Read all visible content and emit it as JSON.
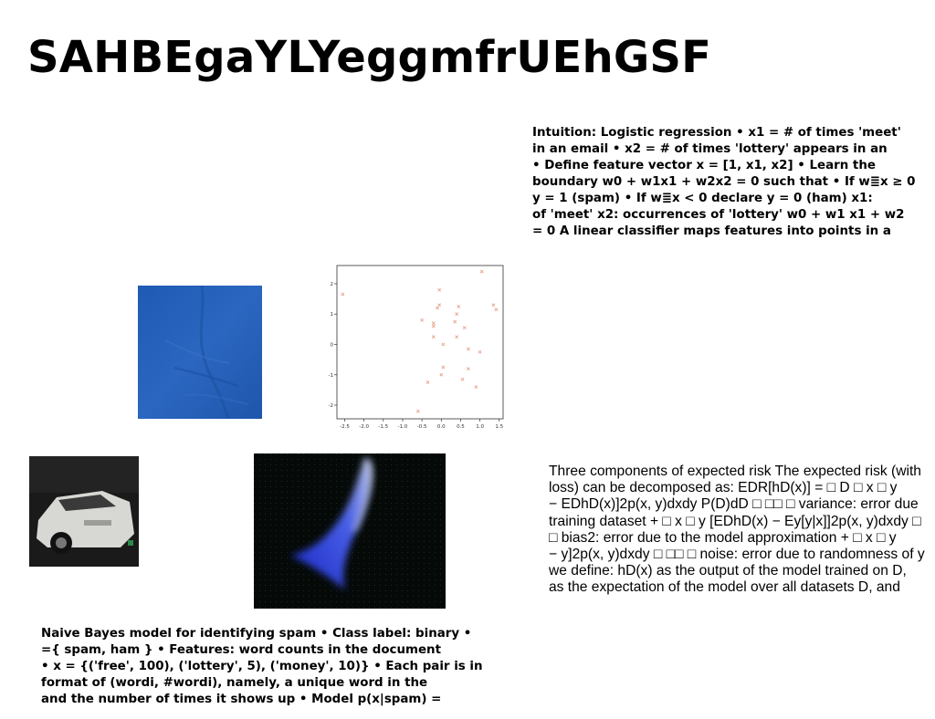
{
  "title": "SAHBEgaYLYeggmfrUEhGSF",
  "right_top_text": [
    "Intuition: Logistic regression • x1 = # of times 'meet'",
    "in an email • x2 = # of times 'lottery' appears in an",
    "• Define feature vector x = [1, x1, x2] • Learn the",
    "boundary w0 + w1x1 + w2x2 = 0 such that • If w≣x ≥ 0",
    "y = 1 (spam) • If w≣x < 0 declare y = 0 (ham) x1:",
    "of 'meet' x2: occurrences of 'lottery' w0 + w1 x1 + w2",
    "= 0 A linear classifier maps features into points in a"
  ],
  "right_bottom_text": [
    "Three components of expected risk The expected risk (with",
    "loss) can be decomposed as: EDR[hD(x)] = □ D □ x □ y",
    "− EDhD(x)]2p(x, y)dxdy P(D)dD □ □□ □ variance: error due",
    "training dataset + □ x □ y [EDhD(x) − Ey[y|x]]2p(x, y)dxdy □",
    "□ bias2: error due to the model approximation + □ x □ y",
    "− y]2p(x, y)dxdy □ □□ □ noise: error due to randomness of y",
    "we define: hD(x) as the output of the model trained on D,",
    "as the expectation of the model over all datasets D, and"
  ],
  "left_bottom_text": [
    "Naive Bayes model for identifying spam • Class label: binary •",
    "={ spam, ham } • Features: word counts in the document",
    "• x = {('free', 100), ('lottery', 5), ('money', 10)} • Each pair is in",
    "format of (wordi, #wordi), namely, a unique word in the",
    "and the number of times it shows up • Model p(x|spam) ="
  ],
  "chart_data": {
    "type": "scatter",
    "title": "",
    "xlabel": "",
    "ylabel": "",
    "xlim": [
      -2.7,
      1.6
    ],
    "ylim": [
      -2.45,
      2.6
    ],
    "xticks": [
      "-2.5",
      "-2.0",
      "-1.5",
      "-1.0",
      "-0.5",
      "0.0",
      "0.5",
      "1.0",
      "1.5"
    ],
    "yticks": [
      "-2",
      "-1",
      "0",
      "1",
      "2"
    ],
    "marker_color": "#e8a28c",
    "points": [
      {
        "x": -2.55,
        "y": 1.65
      },
      {
        "x": -0.6,
        "y": -2.2
      },
      {
        "x": -0.5,
        "y": 0.8
      },
      {
        "x": -0.35,
        "y": -1.25
      },
      {
        "x": -0.2,
        "y": 0.7
      },
      {
        "x": -0.2,
        "y": 0.6
      },
      {
        "x": -0.2,
        "y": 0.25
      },
      {
        "x": -0.1,
        "y": 1.2
      },
      {
        "x": -0.05,
        "y": 1.8
      },
      {
        "x": -0.05,
        "y": 1.3
      },
      {
        "x": 0.0,
        "y": -1.0
      },
      {
        "x": 0.05,
        "y": -0.75
      },
      {
        "x": 0.05,
        "y": 0.0
      },
      {
        "x": 0.35,
        "y": 0.75
      },
      {
        "x": 0.4,
        "y": 1.0
      },
      {
        "x": 0.45,
        "y": 1.25
      },
      {
        "x": 0.4,
        "y": 0.25
      },
      {
        "x": 0.55,
        "y": -1.15
      },
      {
        "x": 0.6,
        "y": 0.55
      },
      {
        "x": 0.7,
        "y": -0.8
      },
      {
        "x": 0.7,
        "y": -0.15
      },
      {
        "x": 0.9,
        "y": -1.4
      },
      {
        "x": 1.0,
        "y": -0.25
      },
      {
        "x": 1.05,
        "y": 2.4
      },
      {
        "x": 1.35,
        "y": 1.3
      },
      {
        "x": 1.42,
        "y": 1.15
      }
    ]
  }
}
